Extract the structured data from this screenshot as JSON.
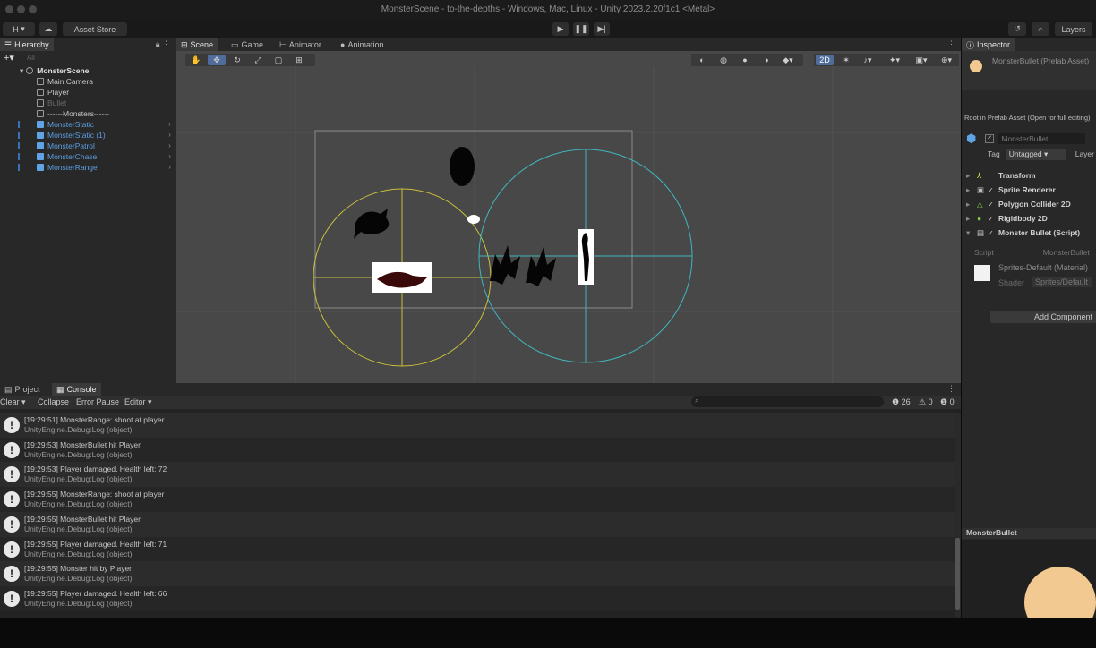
{
  "window": {
    "title": "MonsterScene - to-the-depths - Windows, Mac, Linux - Unity 2023.2.20f1c1 <Metal>"
  },
  "toolbar": {
    "account": "H",
    "asset_store": "Asset Store",
    "layers": "Layers"
  },
  "hierarchy": {
    "tab": "Hierarchy",
    "search_placeholder": "All",
    "scene": "MonsterScene",
    "items": [
      {
        "label": "Main Camera",
        "prefab": false,
        "disabled": false
      },
      {
        "label": "Player",
        "prefab": false,
        "disabled": false
      },
      {
        "label": "Bullet",
        "prefab": false,
        "disabled": true
      },
      {
        "label": "------Monsters------",
        "prefab": false,
        "disabled": false
      },
      {
        "label": "MonsterStatic",
        "prefab": true,
        "disabled": false
      },
      {
        "label": "MonsterStatic (1)",
        "prefab": true,
        "disabled": false
      },
      {
        "label": "MonsterPatrol",
        "prefab": true,
        "disabled": false
      },
      {
        "label": "MonsterChase",
        "prefab": true,
        "disabled": false
      },
      {
        "label": "MonsterRange",
        "prefab": true,
        "disabled": false
      }
    ]
  },
  "scene_tabs": [
    "Scene",
    "Game",
    "Animator",
    "Animation"
  ],
  "scene_toolbar": {
    "mode_2d": "2D"
  },
  "inspector": {
    "tab": "Inspector",
    "asset_name": "MonsterBullet (Prefab Asset)",
    "root_note": "Root in Prefab Asset (Open for full editing)",
    "object_name": "MonsterBullet",
    "tag_label": "Tag",
    "tag_value": "Untagged",
    "layer_label": "Layer",
    "components": [
      "Transform",
      "Sprite Renderer",
      "Polygon Collider 2D",
      "Rigidbody 2D",
      "Monster Bullet (Script)"
    ],
    "script_label": "Script",
    "script_value": "MonsterBullet",
    "material_name": "Sprites-Default (Material)",
    "shader_label": "Shader",
    "shader_value": "Sprites/Default",
    "add_component": "Add Component",
    "preview_title": "MonsterBullet",
    "preview_color": "#f3c992"
  },
  "console": {
    "tabs": [
      "Project",
      "Console"
    ],
    "buttons": {
      "clear": "Clear",
      "collapse": "Collapse",
      "error_pause": "Error Pause",
      "editor": "Editor"
    },
    "counts": {
      "logs": "26",
      "warnings": "0",
      "errors": "0"
    },
    "entries": [
      {
        "msg": "[19:29:51] MonsterRange: shoot at player",
        "detail": "UnityEngine.Debug:Log (object)"
      },
      {
        "msg": "[19:29:53] MonsterBullet hit Player",
        "detail": "UnityEngine.Debug:Log (object)"
      },
      {
        "msg": "[19:29:53] Player damaged. Health left: 72",
        "detail": "UnityEngine.Debug:Log (object)"
      },
      {
        "msg": "[19:29:55] MonsterRange: shoot at player",
        "detail": "UnityEngine.Debug:Log (object)"
      },
      {
        "msg": "[19:29:55] MonsterBullet hit Player",
        "detail": "UnityEngine.Debug:Log (object)"
      },
      {
        "msg": "[19:29:55] Player damaged. Health left: 71",
        "detail": "UnityEngine.Debug:Log (object)"
      },
      {
        "msg": "[19:29:55] Monster hit by Player",
        "detail": "UnityEngine.Debug:Log (object)"
      },
      {
        "msg": "[19:29:55] Player damaged. Health left: 66",
        "detail": "UnityEngine.Debug:Log (object)"
      }
    ]
  }
}
